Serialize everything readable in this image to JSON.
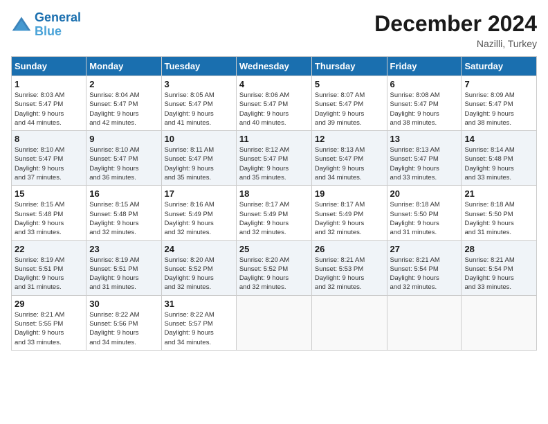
{
  "header": {
    "logo_line1": "General",
    "logo_line2": "Blue",
    "month": "December 2024",
    "location": "Nazilli, Turkey"
  },
  "weekdays": [
    "Sunday",
    "Monday",
    "Tuesday",
    "Wednesday",
    "Thursday",
    "Friday",
    "Saturday"
  ],
  "weeks": [
    [
      {
        "day": "1",
        "rise": "8:03 AM",
        "set": "5:47 PM",
        "hours": "9 hours",
        "mins": "44 minutes."
      },
      {
        "day": "2",
        "rise": "8:04 AM",
        "set": "5:47 PM",
        "hours": "9 hours",
        "mins": "42 minutes."
      },
      {
        "day": "3",
        "rise": "8:05 AM",
        "set": "5:47 PM",
        "hours": "9 hours",
        "mins": "41 minutes."
      },
      {
        "day": "4",
        "rise": "8:06 AM",
        "set": "5:47 PM",
        "hours": "9 hours",
        "mins": "40 minutes."
      },
      {
        "day": "5",
        "rise": "8:07 AM",
        "set": "5:47 PM",
        "hours": "9 hours",
        "mins": "39 minutes."
      },
      {
        "day": "6",
        "rise": "8:08 AM",
        "set": "5:47 PM",
        "hours": "9 hours",
        "mins": "38 minutes."
      },
      {
        "day": "7",
        "rise": "8:09 AM",
        "set": "5:47 PM",
        "hours": "9 hours",
        "mins": "38 minutes."
      }
    ],
    [
      {
        "day": "8",
        "rise": "8:10 AM",
        "set": "5:47 PM",
        "hours": "9 hours",
        "mins": "37 minutes."
      },
      {
        "day": "9",
        "rise": "8:10 AM",
        "set": "5:47 PM",
        "hours": "9 hours",
        "mins": "36 minutes."
      },
      {
        "day": "10",
        "rise": "8:11 AM",
        "set": "5:47 PM",
        "hours": "9 hours",
        "mins": "35 minutes."
      },
      {
        "day": "11",
        "rise": "8:12 AM",
        "set": "5:47 PM",
        "hours": "9 hours",
        "mins": "35 minutes."
      },
      {
        "day": "12",
        "rise": "8:13 AM",
        "set": "5:47 PM",
        "hours": "9 hours",
        "mins": "34 minutes."
      },
      {
        "day": "13",
        "rise": "8:13 AM",
        "set": "5:47 PM",
        "hours": "9 hours",
        "mins": "33 minutes."
      },
      {
        "day": "14",
        "rise": "8:14 AM",
        "set": "5:48 PM",
        "hours": "9 hours",
        "mins": "33 minutes."
      }
    ],
    [
      {
        "day": "15",
        "rise": "8:15 AM",
        "set": "5:48 PM",
        "hours": "9 hours",
        "mins": "33 minutes."
      },
      {
        "day": "16",
        "rise": "8:15 AM",
        "set": "5:48 PM",
        "hours": "9 hours",
        "mins": "32 minutes."
      },
      {
        "day": "17",
        "rise": "8:16 AM",
        "set": "5:49 PM",
        "hours": "9 hours",
        "mins": "32 minutes."
      },
      {
        "day": "18",
        "rise": "8:17 AM",
        "set": "5:49 PM",
        "hours": "9 hours",
        "mins": "32 minutes."
      },
      {
        "day": "19",
        "rise": "8:17 AM",
        "set": "5:49 PM",
        "hours": "9 hours",
        "mins": "32 minutes."
      },
      {
        "day": "20",
        "rise": "8:18 AM",
        "set": "5:50 PM",
        "hours": "9 hours",
        "mins": "31 minutes."
      },
      {
        "day": "21",
        "rise": "8:18 AM",
        "set": "5:50 PM",
        "hours": "9 hours",
        "mins": "31 minutes."
      }
    ],
    [
      {
        "day": "22",
        "rise": "8:19 AM",
        "set": "5:51 PM",
        "hours": "9 hours",
        "mins": "31 minutes."
      },
      {
        "day": "23",
        "rise": "8:19 AM",
        "set": "5:51 PM",
        "hours": "9 hours",
        "mins": "31 minutes."
      },
      {
        "day": "24",
        "rise": "8:20 AM",
        "set": "5:52 PM",
        "hours": "9 hours",
        "mins": "32 minutes."
      },
      {
        "day": "25",
        "rise": "8:20 AM",
        "set": "5:52 PM",
        "hours": "9 hours",
        "mins": "32 minutes."
      },
      {
        "day": "26",
        "rise": "8:21 AM",
        "set": "5:53 PM",
        "hours": "9 hours",
        "mins": "32 minutes."
      },
      {
        "day": "27",
        "rise": "8:21 AM",
        "set": "5:54 PM",
        "hours": "9 hours",
        "mins": "32 minutes."
      },
      {
        "day": "28",
        "rise": "8:21 AM",
        "set": "5:54 PM",
        "hours": "9 hours",
        "mins": "33 minutes."
      }
    ],
    [
      {
        "day": "29",
        "rise": "8:21 AM",
        "set": "5:55 PM",
        "hours": "9 hours",
        "mins": "33 minutes."
      },
      {
        "day": "30",
        "rise": "8:22 AM",
        "set": "5:56 PM",
        "hours": "9 hours",
        "mins": "34 minutes."
      },
      {
        "day": "31",
        "rise": "8:22 AM",
        "set": "5:57 PM",
        "hours": "9 hours",
        "mins": "34 minutes."
      },
      null,
      null,
      null,
      null
    ]
  ],
  "labels": {
    "sunrise": "Sunrise:",
    "sunset": "Sunset:",
    "daylight": "Daylight:"
  }
}
